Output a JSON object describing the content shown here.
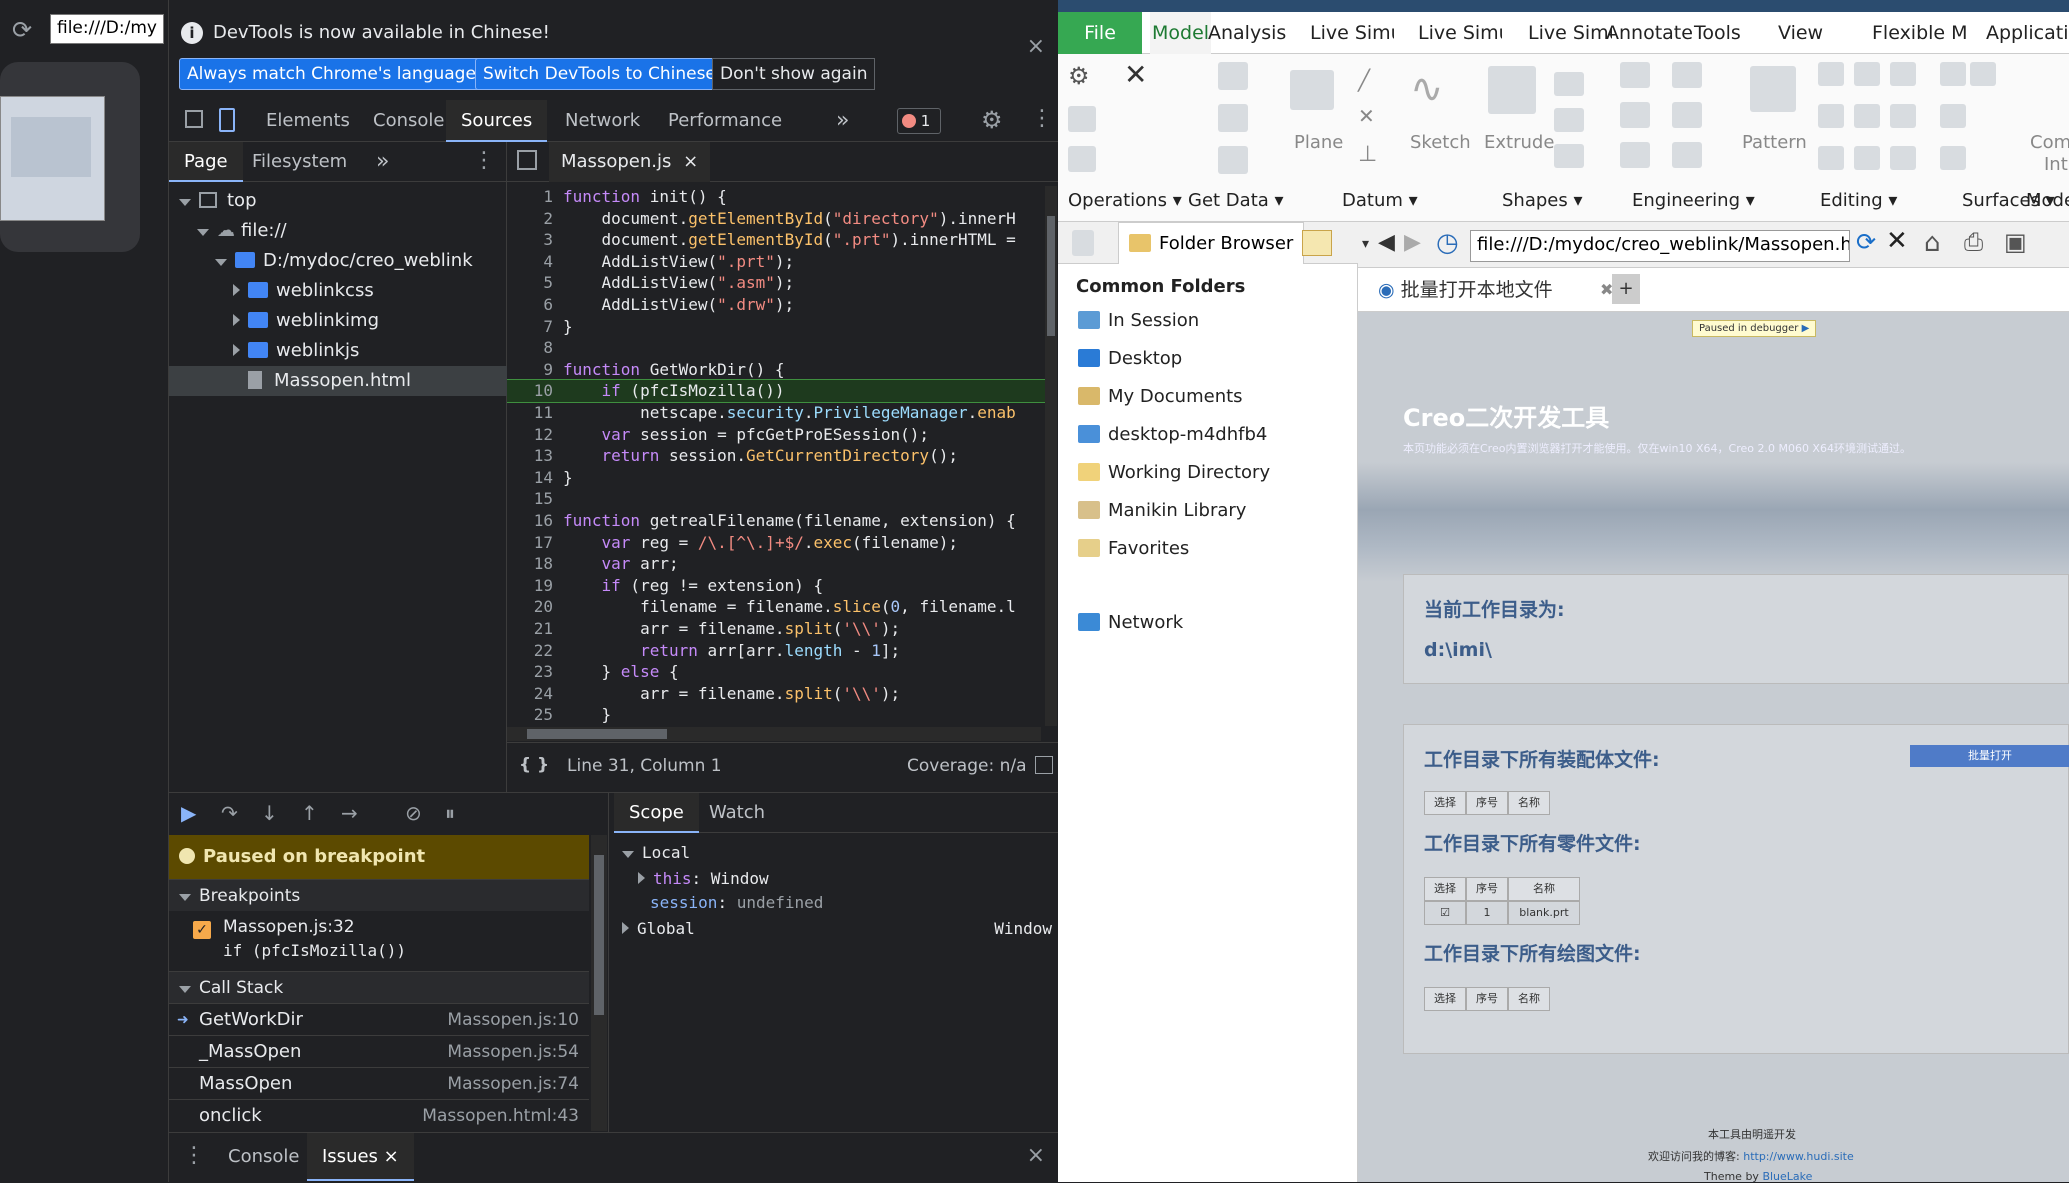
{
  "browser": {
    "address": "file:///D:/my"
  },
  "devtools": {
    "infobar": {
      "message": "DevTools is now available in Chinese!",
      "btn_match": "Always match Chrome's language",
      "btn_switch": "Switch DevTools to Chinese",
      "btn_dont": "Don't show again",
      "close": "×"
    },
    "tabs": [
      "Elements",
      "Console",
      "Sources",
      "Network",
      "Performance"
    ],
    "more": "»",
    "error_count": "1",
    "nav": {
      "tabs": [
        "Page",
        "Filesystem"
      ],
      "more": "»",
      "tree": [
        "top",
        "file://",
        "D:/mydoc/creo_weblink",
        "weblinkcss",
        "weblinkimg",
        "weblinkjs",
        "Massopen.html"
      ]
    },
    "editor": {
      "file_tab": "Massopen.js",
      "close": "×",
      "lines": [
        {
          "n": "1",
          "html": "<span class='kw'>function</span> init() {"
        },
        {
          "n": "2",
          "html": "    document.<span class='fn'>getElementById</span>(<span class='str'>\"directory\"</span>).innerH"
        },
        {
          "n": "3",
          "html": "    document.<span class='fn'>getElementById</span>(<span class='str'>\".prt\"</span>).innerHTML ="
        },
        {
          "n": "4",
          "html": "    AddListView(<span class='str'>\".prt\"</span>);"
        },
        {
          "n": "5",
          "html": "    AddListView(<span class='str'>\".asm\"</span>);"
        },
        {
          "n": "6",
          "html": "    AddListView(<span class='str'>\".drw\"</span>);"
        },
        {
          "n": "7",
          "html": "}"
        },
        {
          "n": "8",
          "html": ""
        },
        {
          "n": "9",
          "html": "<span class='kw'>function</span> GetWorkDir() {"
        },
        {
          "n": "10",
          "html": "    <span class='kw'>if</span> (pfcIsMozilla())"
        },
        {
          "n": "11",
          "html": "        netscape.<span class='m'>security</span>.<span class='m'>PrivilegeManager</span>.<span class='fn'>enab</span>"
        },
        {
          "n": "12",
          "html": "    <span class='kw'>var</span> session = pfcGetProESession();"
        },
        {
          "n": "13",
          "html": "    <span class='kw'>return</span> session.<span class='fn'>GetCurrentDirectory</span>();"
        },
        {
          "n": "14",
          "html": "}"
        },
        {
          "n": "15",
          "html": ""
        },
        {
          "n": "16",
          "html": "<span class='kw'>function</span> getrealFilename(filename, extension) {"
        },
        {
          "n": "17",
          "html": "    <span class='kw'>var</span> reg = <span class='str'>/\\.[^\\.]+$/</span>.<span class='fn'>exec</span>(filename);"
        },
        {
          "n": "18",
          "html": "    <span class='kw'>var</span> arr;"
        },
        {
          "n": "19",
          "html": "    <span class='kw'>if</span> (reg != extension) {"
        },
        {
          "n": "20",
          "html": "        filename = filename.<span class='fn'>slice</span>(<span class='num'>0</span>, filename.l"
        },
        {
          "n": "21",
          "html": "        arr = filename.<span class='fn'>split</span>(<span class='str'>'\\\\'</span>);"
        },
        {
          "n": "22",
          "html": "        <span class='kw'>return</span> arr[arr.<span class='m'>length</span> - <span class='num'>1</span>];"
        },
        {
          "n": "23",
          "html": "    } <span class='kw'>else</span> {"
        },
        {
          "n": "24",
          "html": "        arr = filename.<span class='fn'>split</span>(<span class='str'>'\\\\'</span>);"
        },
        {
          "n": "25",
          "html": "    }"
        }
      ],
      "status": "Line 31, Column 1",
      "coverage": "Coverage: n/a",
      "braces": "{ }"
    },
    "debug": {
      "paused": "Paused on breakpoint",
      "breakpoints_title": "Breakpoints",
      "bp_file": "Massopen.js:32",
      "bp_code": "if (pfcIsMozilla())",
      "callstack_title": "Call Stack",
      "stack": [
        {
          "fn": "GetWorkDir",
          "loc": "Massopen.js:10"
        },
        {
          "fn": "_MassOpen",
          "loc": "Massopen.js:54"
        },
        {
          "fn": "MassOpen",
          "loc": "Massopen.js:74"
        },
        {
          "fn": "onclick",
          "loc": "Massopen.html:43"
        }
      ],
      "scope_tabs": [
        "Scope",
        "Watch"
      ],
      "local": "Local",
      "this_key": "this",
      "this_val": "Window",
      "session_key": "session",
      "session_val": "undefined",
      "global": "Global",
      "global_val": "Window"
    },
    "drawer": {
      "console": "Console",
      "issues": "Issues",
      "close": "×"
    }
  },
  "creo": {
    "menu": [
      "File",
      "Model",
      "Analysis",
      "Live Simu",
      "Live Simu",
      "Live Simu",
      "Annotate",
      "Tools",
      "View",
      "Flexible M",
      "Applicati"
    ],
    "groups": [
      "Operations",
      "Get Data",
      "Datum",
      "Shapes",
      "Engineering",
      "Editing",
      "Surfaces",
      "Mode"
    ],
    "big_labels": [
      "Plane",
      "Sketch",
      "Extrude",
      "Pattern",
      "Com",
      "Int"
    ],
    "folder_tab": "Folder Browser",
    "common_folders": "Common Folders",
    "folders": [
      "In Session",
      "Desktop",
      "My Documents",
      "desktop-m4dhfb4",
      "Working Directory",
      "Manikin Library",
      "Favorites",
      "Network"
    ],
    "url": "file:///D:/mydoc/creo_weblink/Massopen.htm",
    "page_tab": "批量打开本地文件",
    "page": {
      "paused": "Paused in debugger",
      "title": "Creo二次开发工具",
      "subtitle": "本页功能必须在Creo内置浏览器打开才能使用。仅在win10 X64，Creo 2.0 M060 X64环境测试通过。",
      "workdir_label": "当前工作目录为:",
      "workdir": "d:\\imi\\",
      "asm_title": "工作目录下所有装配体文件:",
      "batch_open": "批量打开",
      "prt_title": "工作目录下所有零件文件:",
      "drw_title": "工作目录下所有绘图文件:",
      "headers": [
        "选择",
        "序号",
        "名称"
      ],
      "prt_row": {
        "check": "☑",
        "num": "1",
        "name": "blank.prt"
      },
      "footer1": "本工具由明遥开发",
      "footer2": "欢迎访问我的博客:",
      "footer_link": "http://www.hudi.site",
      "footer3": "Theme by",
      "footer3_link": "BlueLake"
    }
  }
}
